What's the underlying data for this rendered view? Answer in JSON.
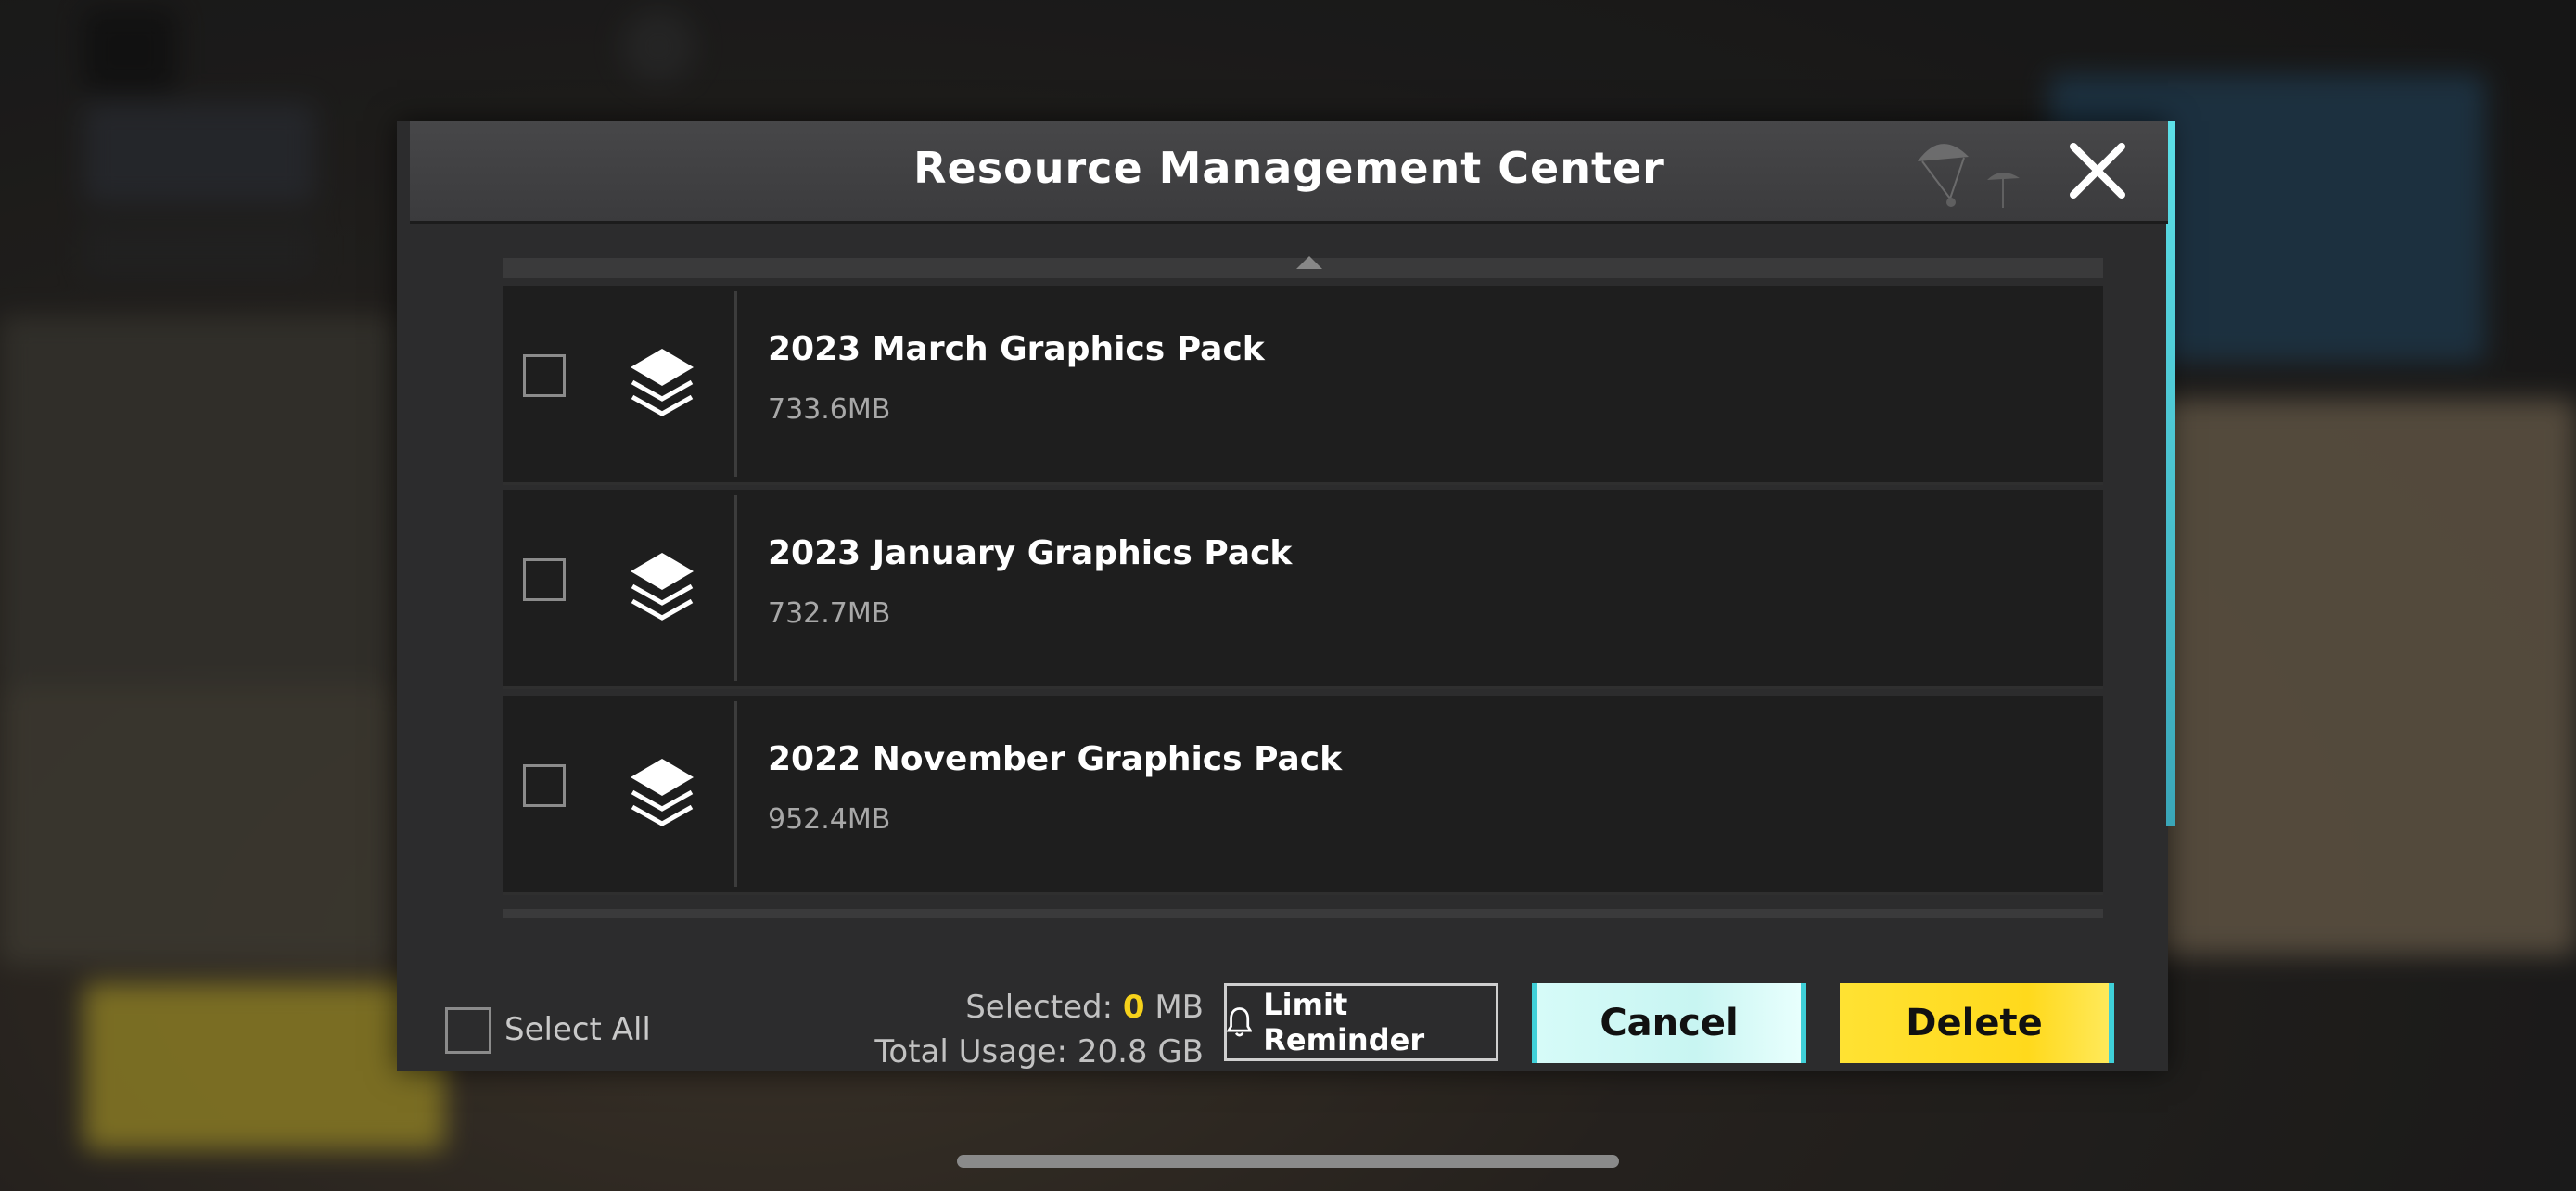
{
  "dialog": {
    "title": "Resource Management Center",
    "close_icon": "close-icon"
  },
  "packs": [
    {
      "name": "2023 March Graphics Pack",
      "size": "733.6MB",
      "checked": false,
      "icon": "layers-icon"
    },
    {
      "name": "2023 January Graphics Pack",
      "size": "732.7MB",
      "checked": false,
      "icon": "layers-icon"
    },
    {
      "name": "2022 November Graphics Pack",
      "size": "952.4MB",
      "checked": false,
      "icon": "layers-icon"
    }
  ],
  "footer": {
    "select_all_label": "Select All",
    "selected_label": "Selected:",
    "selected_value": "0",
    "selected_unit": "MB",
    "total_usage": "Total Usage: 20.8 GB",
    "limit_reminder_label": "Limit Reminder",
    "limit_icon": "bell-icon",
    "cancel_label": "Cancel",
    "delete_label": "Delete"
  },
  "colors": {
    "accent_yellow": "#ffd91c",
    "accent_cyan": "#c8f5f2",
    "panel": "#2c2c2d",
    "row": "#1e1e1e"
  }
}
